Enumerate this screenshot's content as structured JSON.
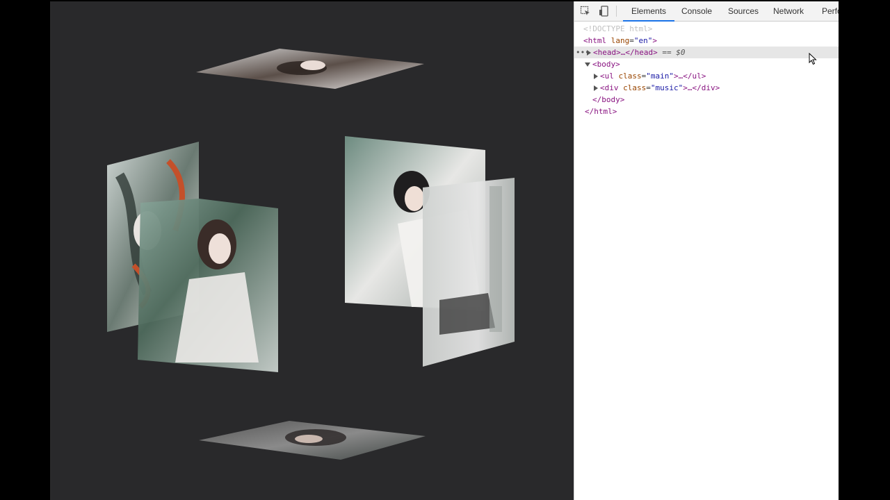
{
  "devtools": {
    "tabs": [
      "Elements",
      "Console",
      "Sources",
      "Network",
      "Perfo"
    ],
    "active_tab": "Elements",
    "dom": {
      "doctype": "<!DOCTYPE html>",
      "html_open_tag": "html",
      "html_attr_name": "lang",
      "html_attr_value": "\"en\"",
      "head_text": "<head>…</head>",
      "head_eq": "== $0",
      "body_open": "<body>",
      "ul_tag": "ul",
      "ul_attr_name": "class",
      "ul_attr_value": "\"main\"",
      "ul_close": ">…</ul>",
      "div_tag": "div",
      "div_attr_name": "class",
      "div_attr_value": "\"music\"",
      "div_close": ">…</div>",
      "body_close": "</body>",
      "html_close": "</html>"
    }
  },
  "icons": [
    "inspect-element-icon",
    "device-toolbar-icon",
    "expand-triangle-icon",
    "mouse-cursor-icon"
  ],
  "colors": {
    "stage_bg": "#29292b",
    "devtools_accent": "#1a73e8",
    "tag_color": "#881280",
    "attr_color": "#994500",
    "value_color": "#1a1aa6"
  }
}
